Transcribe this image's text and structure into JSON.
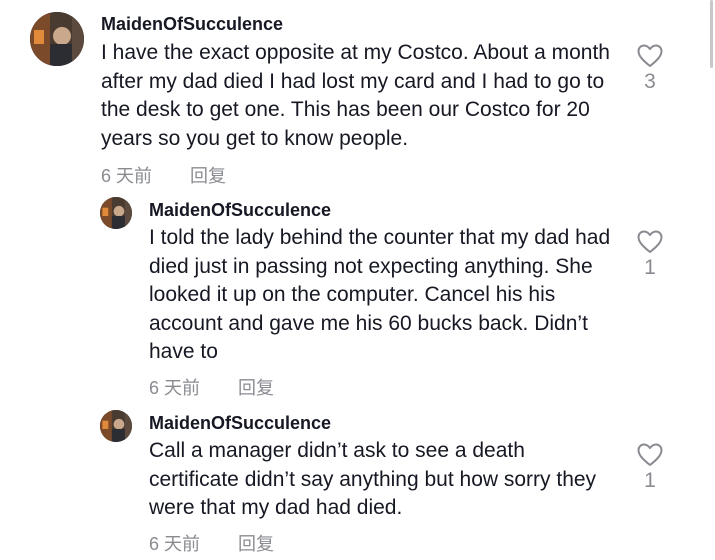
{
  "comments": [
    {
      "username": "MaidenOfSucculence",
      "text": "I have the exact opposite at my Costco. About a month after my dad died I had lost my card and I had to go to the desk to get one. This has been our Costco for 20 years so you get to know people.",
      "time": "6 天前",
      "reply_label": "回复",
      "likes": "3"
    },
    {
      "username": "MaidenOfSucculence",
      "text": "I told the lady behind the counter that my dad had died just in passing not expecting anything. She looked it up on the computer. Cancel his his account and gave me his 60 bucks back. Didn’t have to",
      "time": "6 天前",
      "reply_label": "回复",
      "likes": "1"
    },
    {
      "username": "MaidenOfSucculence",
      "text": "Call a manager didn’t ask to see a death certificate didn’t say anything but how sorry they were that my dad had died.",
      "time": "6 天前",
      "reply_label": "回复",
      "likes": "1"
    }
  ],
  "icons": {
    "like": "heart-outline-icon",
    "avatar": "user-avatar-photo"
  },
  "colors": {
    "text": "#161823",
    "muted": "#8a8b91",
    "background": "#ffffff"
  }
}
